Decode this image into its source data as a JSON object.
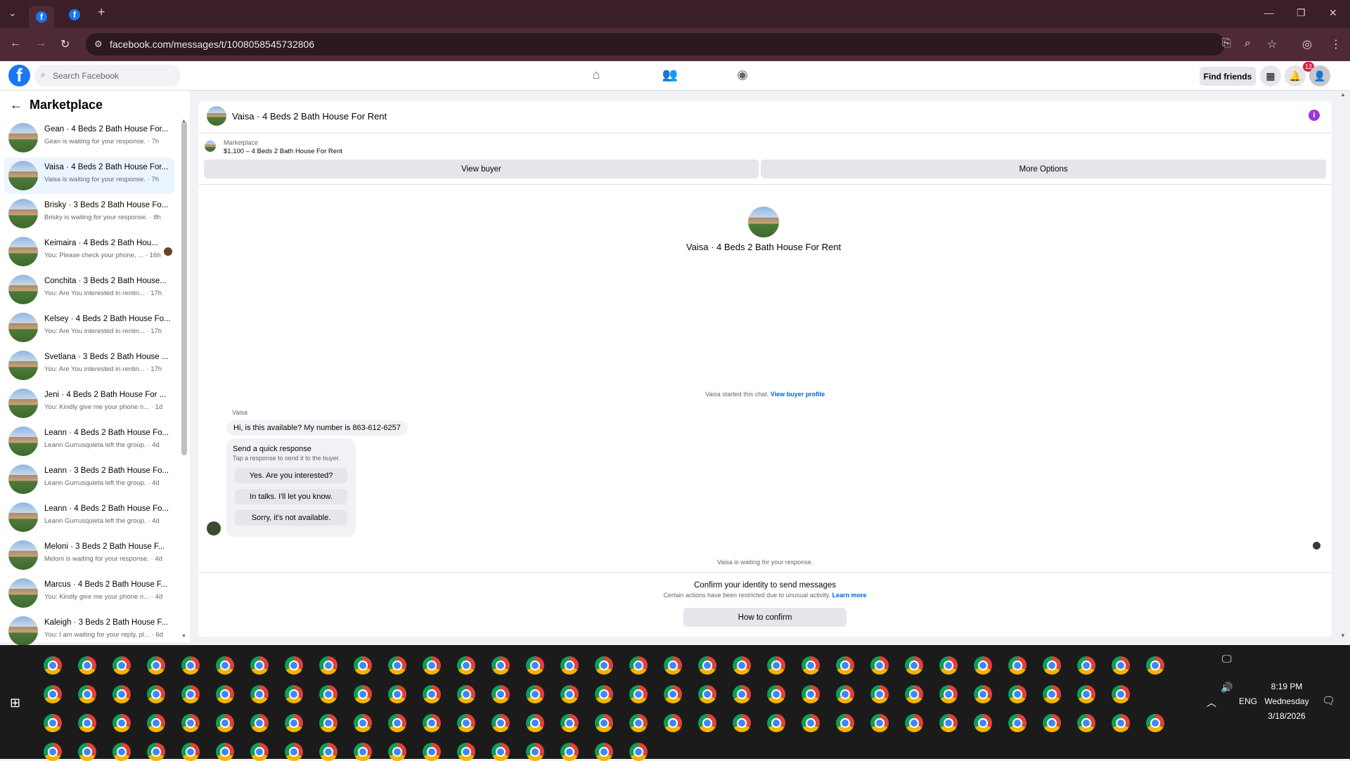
{
  "browser": {
    "url": "facebook.com/messages/t/1008058545732806",
    "new_tab": "+",
    "tab_favicon": "f"
  },
  "header": {
    "search_placeholder": "Search Facebook",
    "find_friends": "Find friends",
    "notification_count": "12",
    "logo": "f"
  },
  "sidebar": {
    "title": "Marketplace",
    "conversations": [
      {
        "name": "Gean · 4 Beds 2 Bath House For...",
        "sub": "Gean is waiting for your response. · 7h",
        "selected": false,
        "dot": false
      },
      {
        "name": "Vaisa · 4 Beds 2 Bath House For...",
        "sub": "Vaisa is waiting for your response. · 7h",
        "selected": true,
        "dot": false
      },
      {
        "name": "Brisky · 3 Beds 2 Bath House Fo...",
        "sub": "Brisky is waiting for your response. · 8h",
        "selected": false,
        "dot": false
      },
      {
        "name": "Keimaira · 4 Beds 2 Bath Hou...",
        "sub": "You: Please check your phone, ... · 16h",
        "selected": false,
        "dot": true
      },
      {
        "name": "Conchita · 3 Beds 2 Bath House...",
        "sub": "You: Are You interested in rentin... · 17h",
        "selected": false,
        "dot": false
      },
      {
        "name": "Kelsey · 4 Beds 2 Bath House Fo...",
        "sub": "You: Are You interested in rentin... · 17h",
        "selected": false,
        "dot": false
      },
      {
        "name": "Svetlana · 3 Beds 2 Bath House ...",
        "sub": "You: Are You interested in rentin... · 17h",
        "selected": false,
        "dot": false
      },
      {
        "name": "Jeni · 4 Beds 2 Bath House For ...",
        "sub": "You: Kindly give me your phone n... · 1d",
        "selected": false,
        "dot": false
      },
      {
        "name": "Leann · 4 Beds 2 Bath House Fo...",
        "sub": "Leann Gurrusquieta left the group. · 4d",
        "selected": false,
        "dot": false
      },
      {
        "name": "Leann · 3 Beds 2 Bath House Fo...",
        "sub": "Leann Gurrusquieta left the group. · 4d",
        "selected": false,
        "dot": false
      },
      {
        "name": "Leann · 4 Beds 2 Bath House Fo...",
        "sub": "Leann Gurrusquieta left the group. · 4d",
        "selected": false,
        "dot": false
      },
      {
        "name": "Meloni · 3 Beds 2 Bath House F...",
        "sub": "Meloni is waiting for your response. · 4d",
        "selected": false,
        "dot": false
      },
      {
        "name": "Marcus · 4 Beds 2 Bath House F...",
        "sub": "You: Kindly give me your phone n... · 4d",
        "selected": false,
        "dot": false
      },
      {
        "name": "Kaleigh · 3 Beds 2 Bath House F...",
        "sub": "You: I am waiting for your reply, pl... · 6d",
        "selected": false,
        "dot": false
      }
    ]
  },
  "thread": {
    "title": "Vaisa · 4 Beds 2 Bath House For Rent",
    "marketplace_label": "Marketplace",
    "listing": "$1,100 – 4 Beds 2 Bath House For Rent",
    "view_buyer": "View buyer",
    "more_options": "More Options",
    "center_title": "Vaisa · 4 Beds 2 Bath House For Rent",
    "started_text": "Vaisa started this chat.",
    "view_buyer_profile": "View buyer profile",
    "sender": "Vaisa",
    "message": "Hi, is this available? My number is 863-612-6257",
    "quick_title": "Send a quick response",
    "quick_sub": "Tap a response to send it to the buyer.",
    "quick_replies": [
      "Yes. Are you interested?",
      "In talks. I'll let you know.",
      "Sorry, it's not available."
    ],
    "waiting": "Vaisa is waiting for your response.",
    "confirm_title": "Confirm your identity to send messages",
    "confirm_sub": "Certain actions have been restricted due to unusual activity.",
    "learn_more": "Learn more",
    "how_to_confirm": "How to confirm"
  },
  "taskbar": {
    "lang": "ENG",
    "time": "8:19 PM",
    "day": "Wednesday",
    "date": "3/18/2026"
  },
  "icons": {
    "home": "home-icon",
    "friends": "friends-icon",
    "groups": "groups-icon",
    "menu": "grid-menu-icon",
    "notifications": "bell-icon",
    "profile": "avatar-icon",
    "info": "info-icon"
  }
}
